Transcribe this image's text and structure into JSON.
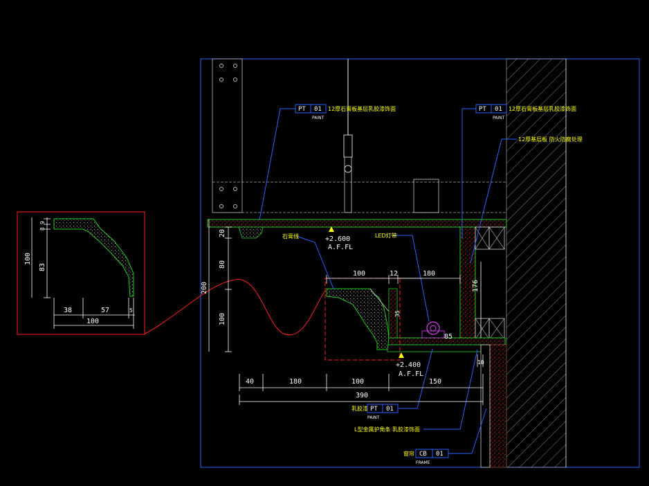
{
  "colors": {
    "background": "#000000",
    "frame": "#2f5fff",
    "leader": "#2a63ff",
    "dimension": "#ffffff",
    "annotation": "#ffff00",
    "detail_frame": "#ff2020",
    "structure": "#22cc22",
    "led": "#e040ff"
  },
  "labels": {
    "tag_pt": "PT",
    "tag_01": "01",
    "tag_paint": "PAINT",
    "tag_cb": "CB",
    "tag_cb_sub": "FRAME",
    "ceiling_note": "12厚石膏板基层乳胶漆饰面",
    "ceiling_note_right": "12厚石膏板基层乳胶漆饰面",
    "fireproof_note": "12厚基层板 防火防腐处理",
    "plaster_line": "石膏线",
    "led_strip": "LED灯带",
    "latex_paint": "乳胶漆",
    "l_profile_note": "L型金属护角条 乳胶漆饰面",
    "curtain_box": "窗帘",
    "level_top": "+2.600",
    "level_top_sub": "A.F.FL",
    "level_bottom": "+2.400",
    "level_bottom_sub": "A.F.FL"
  },
  "dimensions": {
    "d20": "20",
    "d80": "80",
    "d200": "200",
    "d100_v": "100",
    "d100_h": "100",
    "d12": "12",
    "d180_top": "180",
    "d176": "176",
    "d85": "85",
    "d35": "35",
    "d40": "40",
    "d180_bottom": "180",
    "d100_bottom": "100",
    "d150": "150",
    "d390": "390",
    "d10": "10"
  },
  "profile_detail": {
    "h_total": "100",
    "h_9": "9",
    "h_8": "8",
    "h_83": "83",
    "w_38": "38",
    "w_57": "57",
    "w_5": "5",
    "w_total": "100"
  }
}
